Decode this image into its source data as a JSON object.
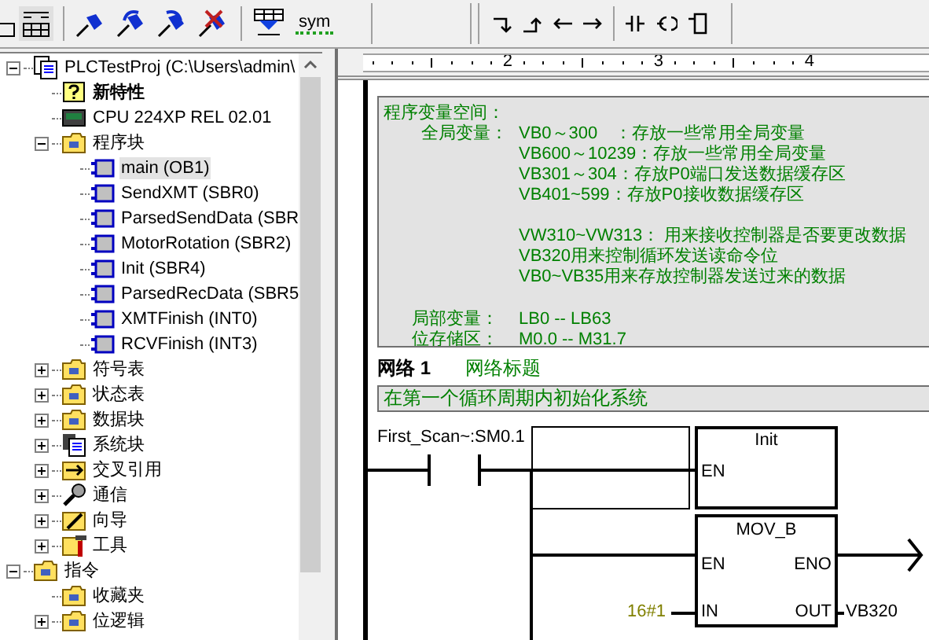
{
  "toolbar": {
    "symbol_button": "sym"
  },
  "tree": [
    {
      "label": "PLCTestProj (C:\\Users\\admin\\",
      "kind": "project",
      "expanded": true,
      "selected": false,
      "children": [
        {
          "label": "新特性",
          "kind": "help",
          "bold": true,
          "selected": false
        },
        {
          "label": "CPU 224XP REL 02.01",
          "kind": "cpu",
          "selected": false
        },
        {
          "label": "程序块",
          "kind": "folder",
          "expanded": true,
          "selected": false,
          "children": [
            {
              "label": "main (OB1)",
              "kind": "block",
              "selected": true
            },
            {
              "label": "SendXMT (SBR0)",
              "kind": "block",
              "selected": false
            },
            {
              "label": "ParsedSendData (SBR",
              "kind": "block",
              "selected": false
            },
            {
              "label": "MotorRotation (SBR2)",
              "kind": "block",
              "selected": false
            },
            {
              "label": "Init (SBR4)",
              "kind": "block",
              "selected": false
            },
            {
              "label": "ParsedRecData (SBR5",
              "kind": "block",
              "selected": false
            },
            {
              "label": "XMTFinish (INT0)",
              "kind": "block",
              "selected": false
            },
            {
              "label": "RCVFinish (INT3)",
              "kind": "block",
              "selected": false
            }
          ]
        },
        {
          "label": "符号表",
          "kind": "folder",
          "expanded": false,
          "selected": false
        },
        {
          "label": "状态表",
          "kind": "folder",
          "expanded": false,
          "selected": false
        },
        {
          "label": "数据块",
          "kind": "folder",
          "expanded": false,
          "selected": false
        },
        {
          "label": "系统块",
          "kind": "system",
          "expanded": false,
          "selected": false
        },
        {
          "label": "交叉引用",
          "kind": "cross",
          "expanded": false,
          "selected": false
        },
        {
          "label": "通信",
          "kind": "comm",
          "expanded": false,
          "selected": false
        },
        {
          "label": "向导",
          "kind": "wizard",
          "expanded": false,
          "selected": false
        },
        {
          "label": "工具",
          "kind": "tools",
          "expanded": false,
          "selected": false
        }
      ]
    },
    {
      "label": "指令",
      "kind": "folder",
      "expanded": true,
      "selected": false,
      "children": [
        {
          "label": "收藏夹",
          "kind": "folder",
          "selected": false
        },
        {
          "label": "位逻辑",
          "kind": "folder",
          "expanded": false,
          "selected": false
        }
      ]
    }
  ],
  "ruler": {
    "labels": [
      "2",
      "3",
      "4"
    ]
  },
  "program_comment": {
    "title": "程序变量空间：",
    "groups": [
      {
        "label": "全局变量：",
        "paragraphs": [
          [
            "VB0～300　：存放一些常用全局变量",
            "VB600～10239：存放一些常用全局变量",
            "VB301～304：存放P0端口发送数据缓存区",
            "VB401~599：存放P0接收数据缓存区"
          ],
          [
            "VW310~VW313：  用来接收控制器是否要更改数据",
            "VB320用来控制循环发送读命令位",
            "VB0~VB35用来存放控制器发送过来的数据"
          ]
        ]
      },
      {
        "label": "局部变量：",
        "paragraphs": [
          [
            "LB0 -- LB63"
          ]
        ]
      },
      {
        "label": "位存储区：",
        "paragraphs": [
          [
            "M0.0 -- M31.7"
          ]
        ]
      }
    ]
  },
  "network": {
    "title": "网络 1",
    "heading": "网络标题",
    "comment": "在第一个循环周期内初始化系统",
    "contact": "First_Scan~:SM0.1",
    "init_box": {
      "title": "Init",
      "en": "EN"
    },
    "move_box": {
      "title": "MOV_B",
      "en": "EN",
      "eno": "ENO",
      "in": "IN",
      "out": "OUT",
      "in_value": "16#1",
      "out_value": "VB320"
    }
  }
}
